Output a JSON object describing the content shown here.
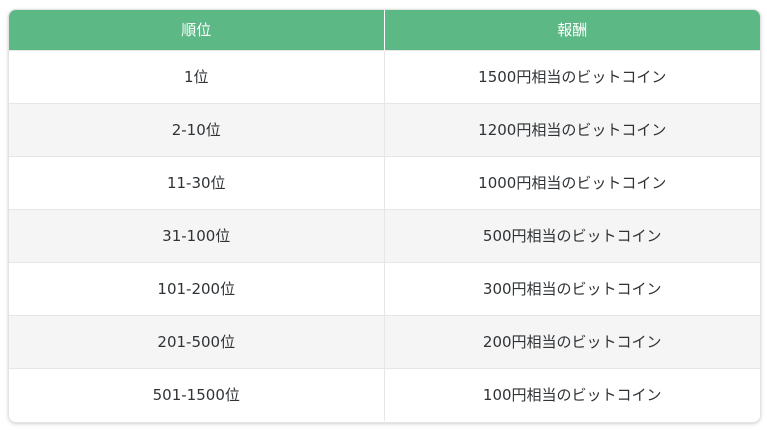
{
  "table": {
    "headers": {
      "rank": "順位",
      "reward": "報酬"
    },
    "rows": [
      {
        "rank": "1位",
        "reward": "1500円相当のビットコイン"
      },
      {
        "rank": "2-10位",
        "reward": "1200円相当のビットコイン"
      },
      {
        "rank": "11-30位",
        "reward": "1000円相当のビットコイン"
      },
      {
        "rank": "31-100位",
        "reward": "500円相当のビットコイン"
      },
      {
        "rank": "101-200位",
        "reward": "300円相当のビットコイン"
      },
      {
        "rank": "201-500位",
        "reward": "200円相当のビットコイン"
      },
      {
        "rank": "501-1500位",
        "reward": "100円相当のビットコイン"
      }
    ]
  },
  "colors": {
    "header_bg": "#5cb885",
    "header_text": "#ffffff",
    "row_alt_bg": "#f5f5f5",
    "body_text": "#2f3336"
  }
}
